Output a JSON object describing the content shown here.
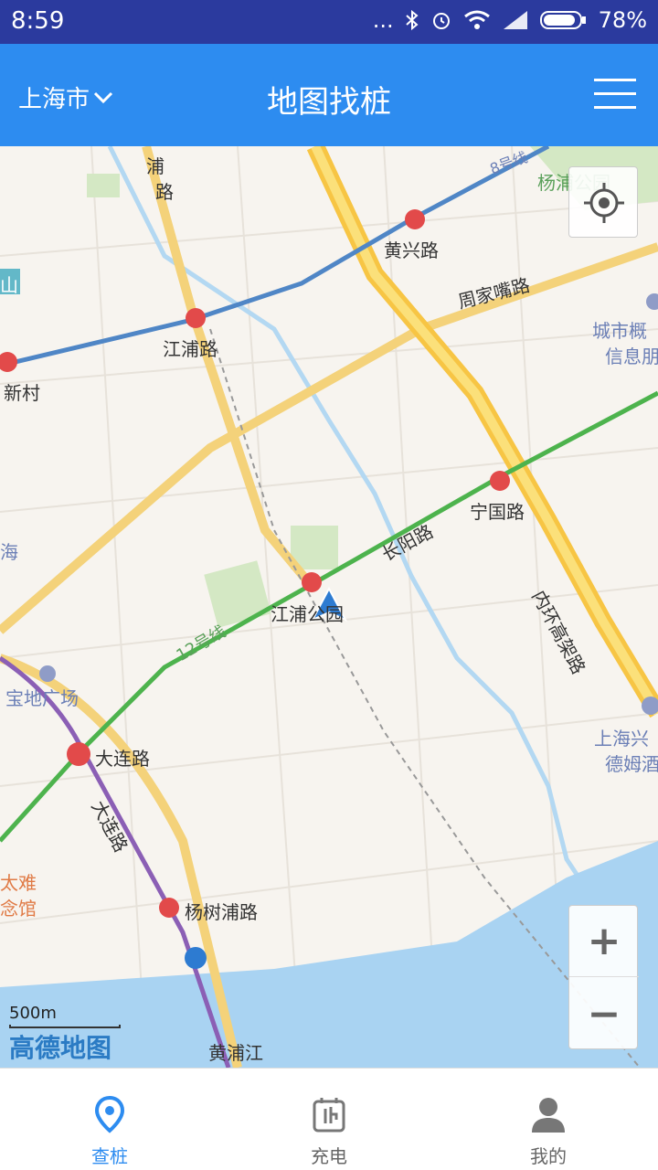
{
  "status": {
    "time": "8:59",
    "dots": "...",
    "battery": "78%"
  },
  "header": {
    "city": "上海市",
    "title": "地图找桩"
  },
  "map": {
    "labels": {
      "yangpu_park": "杨浦公园",
      "huangxing_rd": "黄兴路",
      "zhoujiazui_rd": "周家嘴路",
      "jiangpu_rd": "江浦路",
      "xincun": "新村",
      "city_info_1": "城市概",
      "city_info_2": "信息朋",
      "ningguo_rd": "宁国路",
      "changyang_rd": "长阳路",
      "line12": "12号线",
      "line8": "8号线",
      "jiangpu_park": "江浦公园",
      "neihuan": "内环高架路",
      "baodi": "宝地广场",
      "dalian_rd_station": "大连路",
      "dalian_rd": "大连路",
      "yangshupu_rd": "杨树浦路",
      "hai": "海",
      "shan": "山",
      "shanghai_hotel_1": "上海兴",
      "shanghai_hotel_2": "德姆酒",
      "disaster_1": "太难",
      "disaster_2": "念馆",
      "huangpu": "黄浦江",
      "pu_rd": "浦",
      "lu_rd": "路"
    },
    "scale": "500m",
    "brand": "高德地图",
    "zoom_in": "+",
    "zoom_out": "−"
  },
  "tabs": [
    {
      "label": "查桩",
      "active": true
    },
    {
      "label": "充电",
      "active": false
    },
    {
      "label": "我的",
      "active": false
    }
  ],
  "colors": {
    "header": "#2d8cf0",
    "statusbar": "#2b3a9e",
    "accent": "#2d8cf0",
    "river": "#a9d3f2"
  }
}
